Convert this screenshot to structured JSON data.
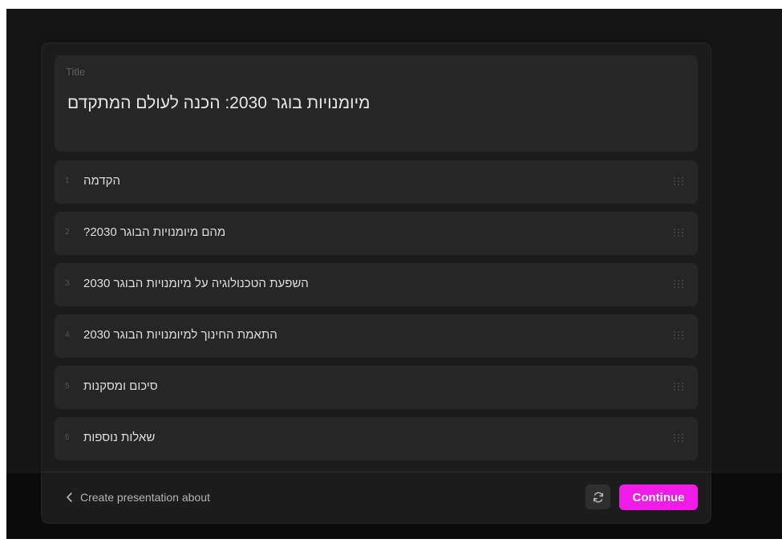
{
  "colors": {
    "accent": "#ee1ce6",
    "background": "#141414",
    "modal": "#1c1c1c",
    "card": "#262626"
  },
  "title_card": {
    "label": "Title",
    "value": "מיומנויות בוגר 2030: הכנה לעולם המתקדם"
  },
  "outline": {
    "items": [
      {
        "number": "1",
        "text": "הקדמה"
      },
      {
        "number": "2",
        "text": "מהם מיומנויות הבוגר 2030?"
      },
      {
        "number": "3",
        "text": "השפעת הטכנולוגיה על מיומנויות הבוגר 2030"
      },
      {
        "number": "4",
        "text": "התאמת החינוך למיומנויות הבוגר 2030"
      },
      {
        "number": "5",
        "text": "סיכום ומסקנות"
      },
      {
        "number": "6",
        "text": "שאלות נוספות"
      }
    ]
  },
  "footer": {
    "back_label": "Create presentation about",
    "back_icon": "chevron-left-icon",
    "refresh_icon": "refresh-icon",
    "continue_label": "Continue"
  }
}
